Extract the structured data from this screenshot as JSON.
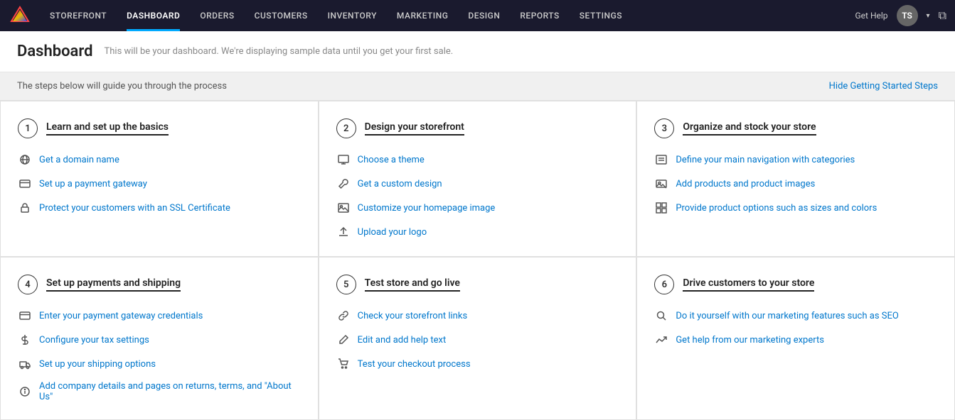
{
  "nav": {
    "logo_symbol": "▽",
    "items": [
      {
        "id": "storefront",
        "label": "STOREFRONT",
        "active": false
      },
      {
        "id": "dashboard",
        "label": "DASHBOARD",
        "active": true
      },
      {
        "id": "orders",
        "label": "ORDERS",
        "active": false
      },
      {
        "id": "customers",
        "label": "CUSTOMERS",
        "active": false
      },
      {
        "id": "inventory",
        "label": "INVENTORY",
        "active": false
      },
      {
        "id": "marketing",
        "label": "MARKETING",
        "active": false
      },
      {
        "id": "design",
        "label": "DESIGN",
        "active": false
      },
      {
        "id": "reports",
        "label": "REPORTS",
        "active": false
      },
      {
        "id": "settings",
        "label": "SETTINGS",
        "active": false
      }
    ],
    "help_label": "Get Help",
    "avatar_initials": "TS"
  },
  "page": {
    "title": "Dashboard",
    "subtitle": "This will be your dashboard. We're displaying sample data until you get your first sale."
  },
  "getting_started": {
    "text": "The steps below will guide you through the process",
    "hide_label": "Hide Getting Started Steps"
  },
  "steps": [
    {
      "number": "1",
      "title": "Learn and set up the basics",
      "items": [
        {
          "icon": "globe",
          "label": "Get a domain name"
        },
        {
          "icon": "credit-card",
          "label": "Set up a payment gateway"
        },
        {
          "icon": "lock",
          "label": "Protect your customers with an SSL Certificate"
        }
      ]
    },
    {
      "number": "2",
      "title": "Design your storefront",
      "items": [
        {
          "icon": "monitor",
          "label": "Choose a theme"
        },
        {
          "icon": "wrench",
          "label": "Get a custom design"
        },
        {
          "icon": "image",
          "label": "Customize your homepage image"
        },
        {
          "icon": "upload",
          "label": "Upload your logo"
        }
      ]
    },
    {
      "number": "3",
      "title": "Organize and stock your store",
      "items": [
        {
          "icon": "list",
          "label": "Define your main navigation with categories"
        },
        {
          "icon": "photo",
          "label": "Add products and product images"
        },
        {
          "icon": "grid",
          "label": "Provide product options such as sizes and colors"
        }
      ]
    },
    {
      "number": "4",
      "title": "Set up payments and shipping",
      "items": [
        {
          "icon": "credit-card",
          "label": "Enter your payment gateway credentials"
        },
        {
          "icon": "dollar",
          "label": "Configure your tax settings"
        },
        {
          "icon": "truck",
          "label": "Set up your shipping options"
        },
        {
          "icon": "info",
          "label": "Add company details and pages on returns, terms, and \"About Us\""
        }
      ]
    },
    {
      "number": "5",
      "title": "Test store and go live",
      "items": [
        {
          "icon": "link",
          "label": "Check your storefront links"
        },
        {
          "icon": "pencil",
          "label": "Edit and add help text"
        },
        {
          "icon": "cart",
          "label": "Test your checkout process"
        }
      ]
    },
    {
      "number": "6",
      "title": "Drive customers to your store",
      "items": [
        {
          "icon": "search",
          "label": "Do it yourself with our marketing features such as SEO"
        },
        {
          "icon": "trend",
          "label": "Get help from our marketing experts"
        }
      ]
    }
  ]
}
